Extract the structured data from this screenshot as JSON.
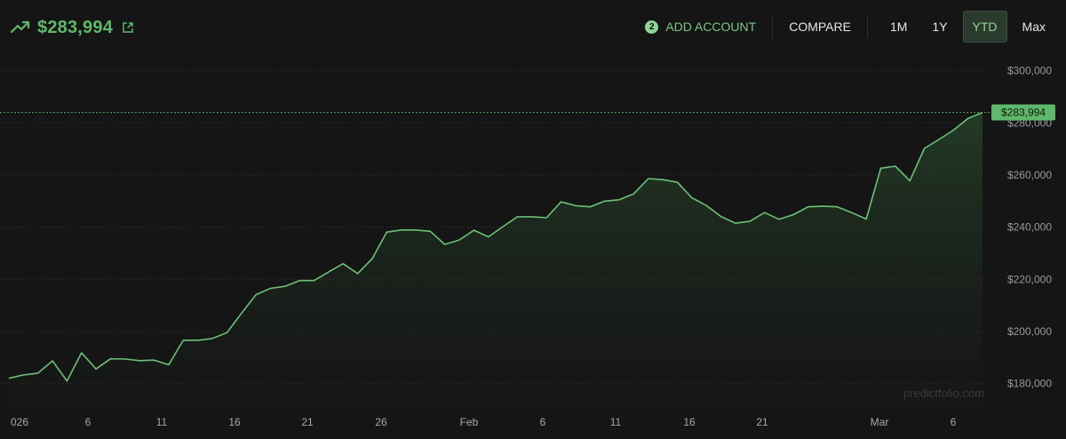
{
  "header": {
    "value": "$283,994",
    "trend_icon": "trending-up-icon",
    "external_icon": "external-link-icon",
    "add_account": {
      "badge": "2",
      "label": "ADD ACCOUNT"
    },
    "compare_label": "COMPARE",
    "ranges": [
      "1M",
      "1Y",
      "YTD",
      "Max"
    ],
    "active_range": "YTD"
  },
  "colors": {
    "background": "#151515",
    "accent": "#5fb86b",
    "line": "#6cc177",
    "tag": "#5fb86b"
  },
  "chart_data": {
    "type": "area",
    "x_labels": [
      "026",
      "6",
      "11",
      "16",
      "21",
      "26",
      "Feb",
      "6",
      "11",
      "16",
      "21",
      "Mar",
      "6"
    ],
    "y_ticks": [
      "$180,000",
      "$200,000",
      "$220,000",
      "$240,000",
      "$260,000",
      "$280,000",
      "$300,000"
    ],
    "y_tick_values": [
      180000,
      200000,
      220000,
      240000,
      260000,
      280000,
      300000
    ],
    "ylim": [
      171000,
      306000
    ],
    "grid": "horizontal dashed",
    "current_value": 283994,
    "current_label": "$283,994",
    "watermark": "predictfolio.com",
    "values": [
      182000,
      183300,
      184000,
      188700,
      181000,
      191800,
      185600,
      189500,
      189400,
      188800,
      189000,
      187200,
      196600,
      196600,
      197300,
      199500,
      206900,
      214100,
      216500,
      217300,
      219500,
      219500,
      222800,
      226000,
      222200,
      227900,
      238100,
      238900,
      238900,
      238400,
      233400,
      235100,
      238800,
      236300,
      240200,
      244000,
      244000,
      243600,
      249700,
      248200,
      247800,
      250000,
      250500,
      252800,
      258600,
      258200,
      257200,
      251300,
      248300,
      244100,
      241500,
      242300,
      245600,
      243000,
      244800,
      247800,
      248000,
      247800,
      245600,
      243100,
      262600,
      263400,
      257800,
      270200,
      273600,
      277200,
      281700,
      283994
    ]
  }
}
